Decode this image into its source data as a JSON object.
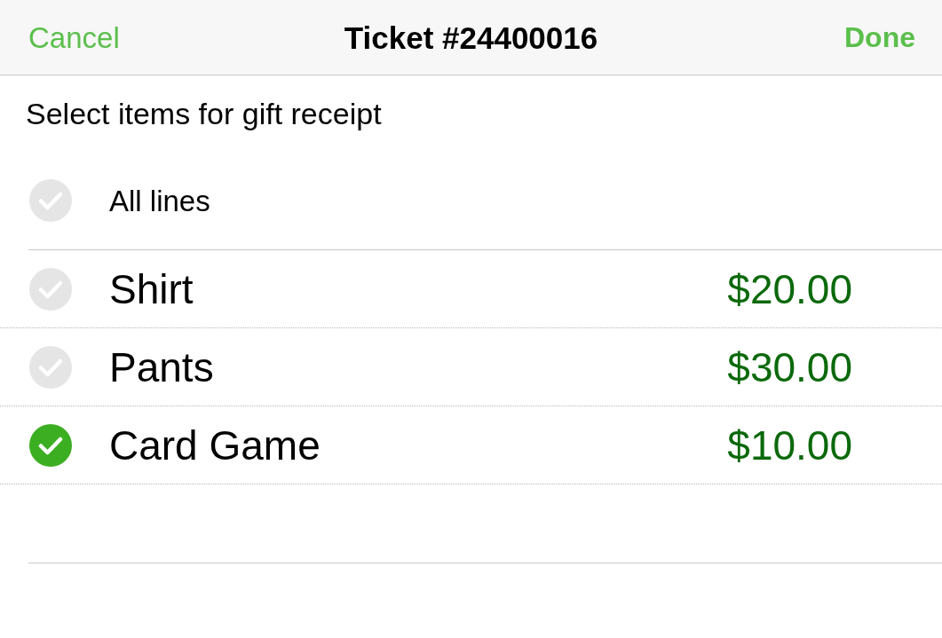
{
  "nav": {
    "cancel": "Cancel",
    "title": "Ticket #24400016",
    "done": "Done"
  },
  "instruction": "Select items for gift receipt",
  "all_lines": {
    "label": "All lines",
    "checked": false
  },
  "items": [
    {
      "name": "Shirt",
      "price": "$20.00",
      "checked": false
    },
    {
      "name": "Pants",
      "price": "$30.00",
      "checked": false
    },
    {
      "name": "Card Game",
      "price": "$10.00",
      "checked": true
    }
  ]
}
